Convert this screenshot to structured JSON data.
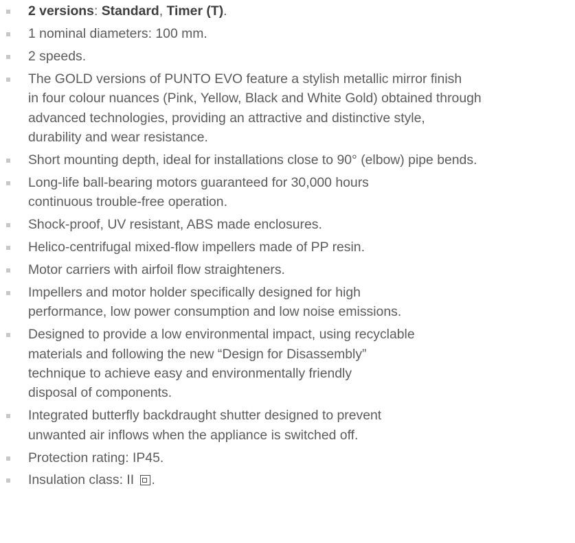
{
  "features": {
    "versions": {
      "label": "2 versions",
      "sep1": ": ",
      "standard": "Standard",
      "sep2": ", ",
      "timer": "Timer (T)",
      "end": "."
    },
    "diameters": "1 nominal diameters: 100 mm.",
    "speeds": "2 speeds.",
    "gold": [
      "The GOLD versions of PUNTO EVO feature a stylish metallic mirror finish",
      "in four colour nuances (Pink, Yellow, Black and White Gold) obtained through",
      "advanced technologies, providing an attractive and distinctive style,",
      "durability and wear resistance."
    ],
    "mounting": "Short mounting depth, ideal for installations close to 90° (elbow) pipe bends.",
    "motors": [
      "Long-life ball-bearing motors guaranteed for 30,000 hours",
      "continuous trouble-free operation."
    ],
    "enclosures": "Shock-proof, UV resistant, ABS made enclosures.",
    "impellers": "Helico-centrifugal mixed-flow impellers made of PP resin.",
    "carriers": "Motor carriers with airfoil flow straighteners.",
    "performance": [
      "Impellers and motor holder specifically designed for high",
      "performance, low power consumption and low noise emissions."
    ],
    "environment": [
      "Designed to provide a low environmental impact, using recyclable",
      "materials and following the new “Design for Disassembly”",
      "technique to achieve easy and environmentally friendly",
      "disposal of components."
    ],
    "shutter": [
      "Integrated butterfly backdraught shutter designed to prevent",
      "unwanted air inflows when the appliance is switched off."
    ],
    "protection": "Protection rating: IP45.",
    "insulation": {
      "text": "Insulation class: II",
      "symbol_icon": "double-insulation-icon",
      "end": "."
    }
  },
  "colors": {
    "text": "#5b5b5b",
    "bullet": "#c8c8c8"
  }
}
